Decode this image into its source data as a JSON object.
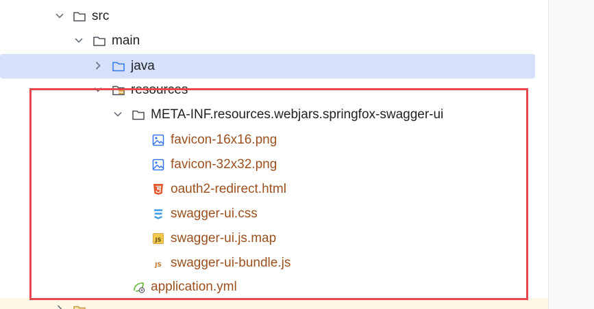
{
  "tree": {
    "src": {
      "label": "src"
    },
    "main": {
      "label": "main"
    },
    "java": {
      "label": "java"
    },
    "resources": {
      "label": "resources"
    },
    "meta_inf": {
      "label": "META-INF.resources.webjars.springfox-swagger-ui"
    },
    "files": [
      {
        "label": "favicon-16x16.png",
        "icon": "image-file-icon"
      },
      {
        "label": "favicon-32x32.png",
        "icon": "image-file-icon"
      },
      {
        "label": "oauth2-redirect.html",
        "icon": "html5-icon"
      },
      {
        "label": "swagger-ui.css",
        "icon": "css3-icon"
      },
      {
        "label": "swagger-ui.js.map",
        "icon": "js-map-icon"
      },
      {
        "label": "swagger-ui-bundle.js",
        "icon": "js-file-icon"
      }
    ],
    "application": {
      "label": "application.yml",
      "icon": "spring-config-icon"
    }
  },
  "colors": {
    "selection": "#d5e1fb",
    "highlight_border": "#e5484d",
    "file_text": "#9b4f1c",
    "folder_stroke": "#4a4d55",
    "source_folder": "#3574f0"
  }
}
